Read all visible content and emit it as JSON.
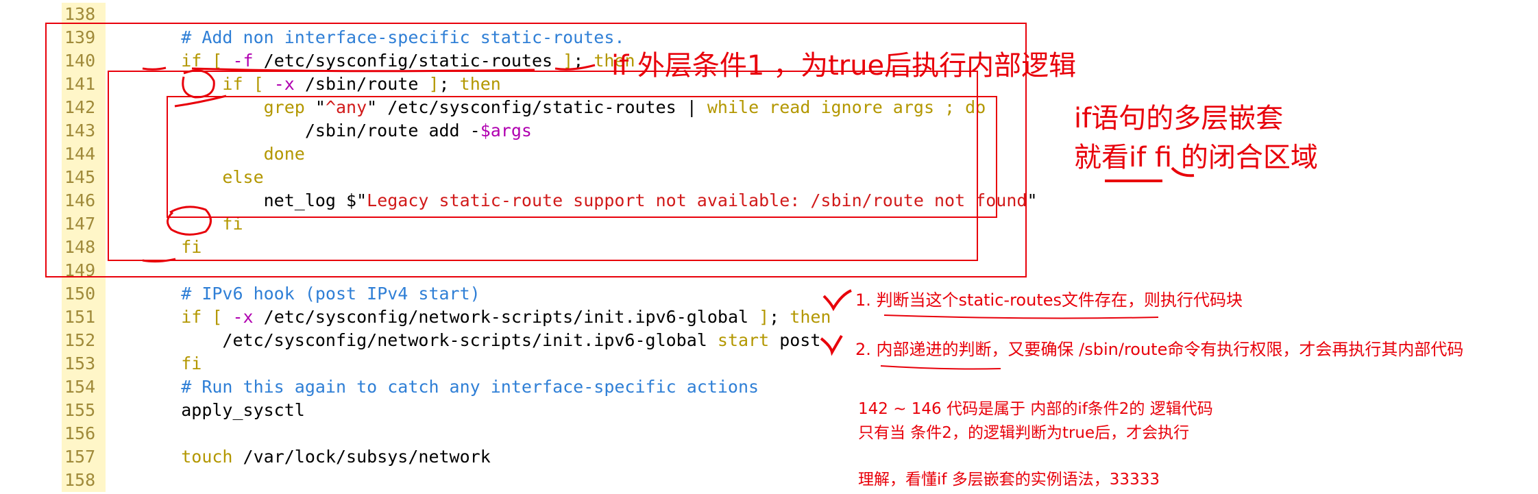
{
  "code_lines": [
    {
      "num": "138",
      "segs": []
    },
    {
      "num": "139",
      "segs": [
        {
          "t": "    ",
          "c": "plain"
        },
        {
          "t": "# Add non interface-specific static-routes.",
          "c": "cm"
        }
      ]
    },
    {
      "num": "140",
      "segs": [
        {
          "t": "    ",
          "c": "plain"
        },
        {
          "t": "if",
          "c": "kw"
        },
        {
          "t": " [ ",
          "c": "kw"
        },
        {
          "t": "-f",
          "c": "opt"
        },
        {
          "t": " /etc/sysconfig/static-routes ",
          "c": "plain"
        },
        {
          "t": "]",
          "c": "kw"
        },
        {
          "t": "; ",
          "c": "plain"
        },
        {
          "t": "then",
          "c": "kw"
        }
      ]
    },
    {
      "num": "141",
      "segs": [
        {
          "t": "        ",
          "c": "plain"
        },
        {
          "t": "if",
          "c": "kw"
        },
        {
          "t": " [ ",
          "c": "kw"
        },
        {
          "t": "-x",
          "c": "opt"
        },
        {
          "t": " /sbin/route ",
          "c": "plain"
        },
        {
          "t": "]",
          "c": "kw"
        },
        {
          "t": "; ",
          "c": "plain"
        },
        {
          "t": "then",
          "c": "kw"
        }
      ]
    },
    {
      "num": "142",
      "segs": [
        {
          "t": "            ",
          "c": "plain"
        },
        {
          "t": "grep",
          "c": "kw"
        },
        {
          "t": " \"",
          "c": "plain"
        },
        {
          "t": "^any",
          "c": "str"
        },
        {
          "t": "\" /etc/sysconfig/static-routes | ",
          "c": "plain"
        },
        {
          "t": "while read ignore args ; do",
          "c": "kw"
        }
      ]
    },
    {
      "num": "143",
      "segs": [
        {
          "t": "                ",
          "c": "plain"
        },
        {
          "t": "/sbin/route add -",
          "c": "plain"
        },
        {
          "t": "$args",
          "c": "var"
        }
      ]
    },
    {
      "num": "144",
      "segs": [
        {
          "t": "            ",
          "c": "plain"
        },
        {
          "t": "done",
          "c": "kw"
        }
      ]
    },
    {
      "num": "145",
      "segs": [
        {
          "t": "        ",
          "c": "plain"
        },
        {
          "t": "else",
          "c": "kw"
        }
      ]
    },
    {
      "num": "146",
      "segs": [
        {
          "t": "            ",
          "c": "plain"
        },
        {
          "t": "net_log ",
          "c": "plain"
        },
        {
          "t": "$\"",
          "c": "plain"
        },
        {
          "t": "Legacy static-route support not available: /sbin/route not found",
          "c": "str"
        },
        {
          "t": "\"",
          "c": "plain"
        }
      ]
    },
    {
      "num": "147",
      "segs": [
        {
          "t": "        ",
          "c": "plain"
        },
        {
          "t": "fi",
          "c": "kw"
        }
      ]
    },
    {
      "num": "148",
      "segs": [
        {
          "t": "    ",
          "c": "plain"
        },
        {
          "t": "fi",
          "c": "kw"
        }
      ]
    },
    {
      "num": "149",
      "segs": []
    },
    {
      "num": "150",
      "segs": [
        {
          "t": "    ",
          "c": "plain"
        },
        {
          "t": "# IPv6 hook (post IPv4 start)",
          "c": "cm"
        }
      ]
    },
    {
      "num": "151",
      "segs": [
        {
          "t": "    ",
          "c": "plain"
        },
        {
          "t": "if",
          "c": "kw"
        },
        {
          "t": " [ ",
          "c": "kw"
        },
        {
          "t": "-x",
          "c": "opt"
        },
        {
          "t": " /etc/sysconfig/network-scripts/init.ipv6-global ",
          "c": "plain"
        },
        {
          "t": "]",
          "c": "kw"
        },
        {
          "t": "; ",
          "c": "plain"
        },
        {
          "t": "then",
          "c": "kw"
        }
      ]
    },
    {
      "num": "152",
      "segs": [
        {
          "t": "        ",
          "c": "plain"
        },
        {
          "t": "/etc/sysconfig/network-scripts/init.ipv6-global ",
          "c": "plain"
        },
        {
          "t": "start",
          "c": "kw"
        },
        {
          "t": " post",
          "c": "plain"
        }
      ]
    },
    {
      "num": "153",
      "segs": [
        {
          "t": "    ",
          "c": "plain"
        },
        {
          "t": "fi",
          "c": "kw"
        }
      ]
    },
    {
      "num": "154",
      "segs": [
        {
          "t": "    ",
          "c": "plain"
        },
        {
          "t": "# Run this again to catch any interface-specific actions",
          "c": "cm"
        }
      ]
    },
    {
      "num": "155",
      "segs": [
        {
          "t": "    ",
          "c": "plain"
        },
        {
          "t": "apply_sysctl",
          "c": "plain"
        }
      ]
    },
    {
      "num": "156",
      "segs": []
    },
    {
      "num": "157",
      "segs": [
        {
          "t": "    ",
          "c": "plain"
        },
        {
          "t": "touch",
          "c": "kw"
        },
        {
          "t": " /var/lock/subsys/network",
          "c": "plain"
        }
      ]
    },
    {
      "num": "158",
      "segs": []
    }
  ],
  "annotations": {
    "cond1": "if  外层条件1 ，为true后执行内部逻辑",
    "nest_title_1": "if语句的多层嵌套",
    "nest_title_2": "就看if   fi  的闭合区域",
    "note1": "1. 判断当这个static-routes文件存在，则执行代码块",
    "note2": "2. 内部递进的判断，又要确保 /sbin/route命令有执行权限，才会再执行其内部代码",
    "note3a": "142 ~ 146 代码是属于  内部的if条件2的  逻辑代码",
    "note3b": "只有当 条件2，的逻辑判断为true后，才会执行",
    "note4": "理解，看懂if 多层嵌套的实例语法，33333"
  },
  "colors": {
    "comment": "#2f7fd6",
    "keyword": "#b39700",
    "string": "#d11a1a",
    "variable": "#b000b0",
    "annotation": "#e8000a"
  }
}
